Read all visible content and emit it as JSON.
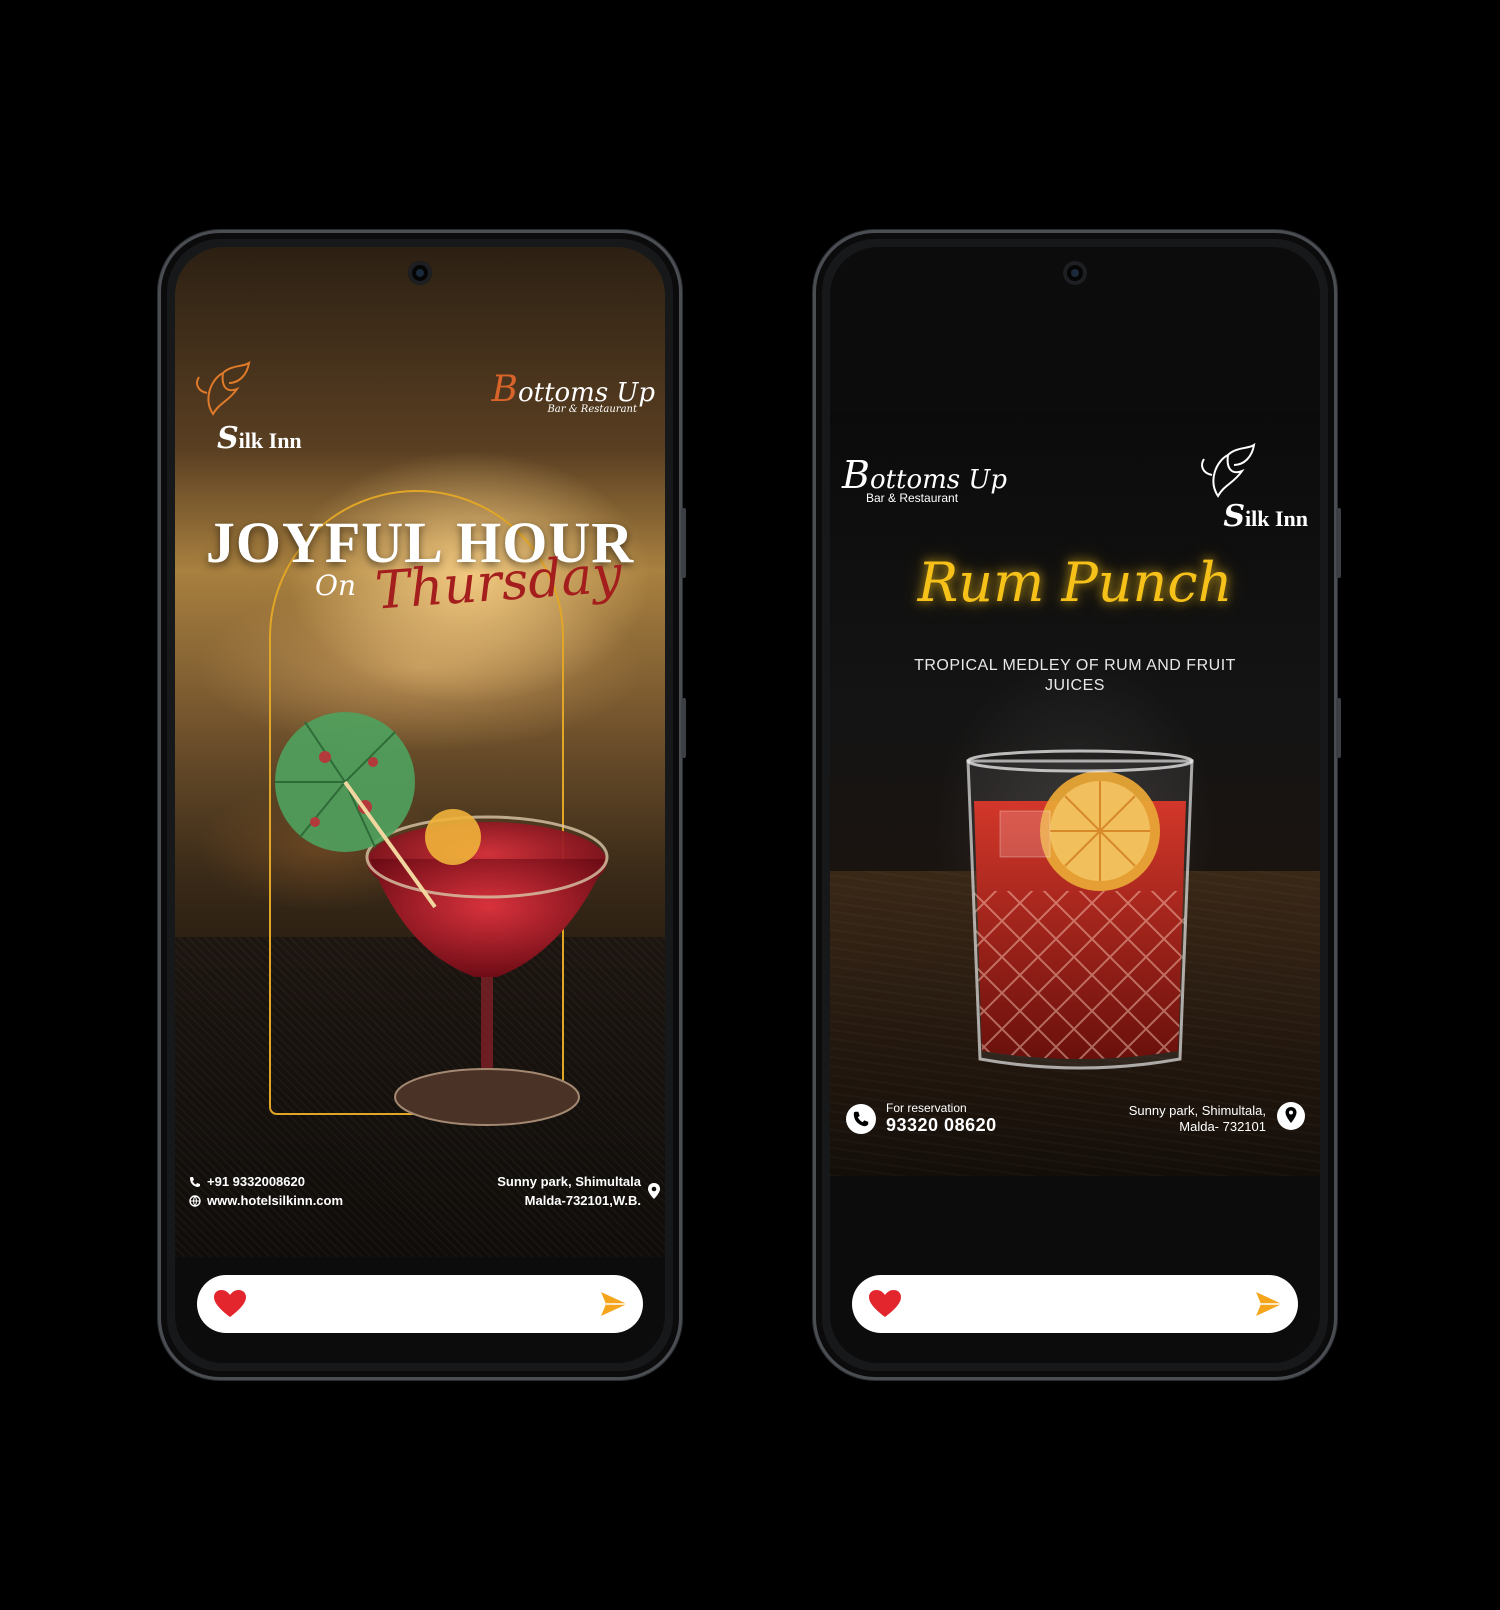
{
  "left_story": {
    "brand_silk": "ilk Inn",
    "brand_silk_initial": "S",
    "brand_bu_cap": "B",
    "brand_bu_rest": "ottoms Up",
    "brand_bu_sub": "Bar & Restaurant",
    "title_main": "JOYFUL HOUR",
    "title_on": "On",
    "title_day": "Thursday",
    "phone": "+91 9332008620",
    "website": "www.hotelsilkinn.com",
    "address_line1": "Sunny park, Shimultala",
    "address_line2": "Malda-732101,W.B.",
    "icons": [
      "phone-icon",
      "globe-icon",
      "location-pin-icon",
      "heart-icon",
      "send-icon"
    ],
    "colors": {
      "accent_gold": "#e2a626",
      "script_red": "#a51e1e",
      "brand_orange": "#d9642a"
    }
  },
  "right_story": {
    "brand_bu_cap": "B",
    "brand_bu_rest": "ottoms Up",
    "brand_bu_sub": "Bar & Restaurant",
    "brand_silk": "ilk Inn",
    "brand_silk_initial": "S",
    "title": "Rum Punch",
    "tagline": "TROPICAL MEDLEY OF RUM AND FRUIT JUICES",
    "reservation_label": "For reservation",
    "reservation_number": "93320 08620",
    "address_line1": "Sunny park, Shimultala,",
    "address_line2": "Malda- 732101",
    "icons": [
      "phone-icon",
      "location-pin-icon",
      "heart-icon",
      "send-icon"
    ],
    "colors": {
      "title_gold": "#f6c21a"
    }
  },
  "reply": {
    "placeholder": ""
  },
  "colors": {
    "heart_red": "#e3262e",
    "send_orange": "#f4a51c",
    "frame": "#4a4d52"
  }
}
